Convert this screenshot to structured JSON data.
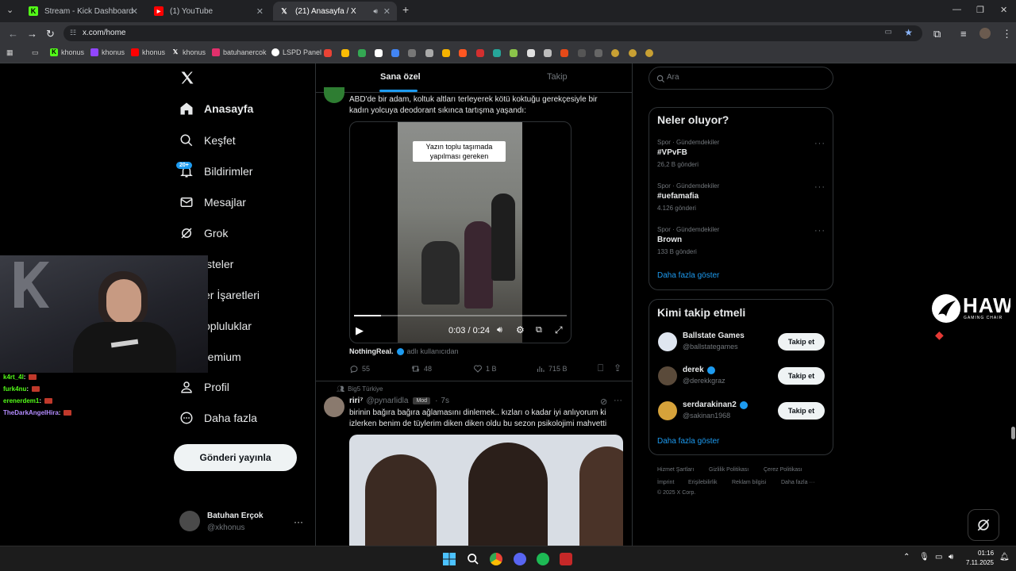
{
  "browser": {
    "tabs": [
      {
        "label": "Stream - Kick Dashboard",
        "icon": "kick-icon"
      },
      {
        "label": "(1) YouTube",
        "icon": "youtube-icon"
      },
      {
        "label": "(21) Anasayfa / X",
        "icon": "x-icon"
      }
    ],
    "url": "x.com/home",
    "bookmarks": [
      {
        "label": "khonus",
        "icon": "kick-icon",
        "color": "#53fc18"
      },
      {
        "label": "khonus",
        "icon": "twitch-icon",
        "color": "#9146ff"
      },
      {
        "label": "khonus",
        "icon": "youtube-icon",
        "color": "#ff0000"
      },
      {
        "label": "khonus",
        "icon": "x-icon",
        "color": "#ffffff"
      },
      {
        "label": "batuhanercok",
        "icon": "instagram-icon",
        "color": "#e1306c"
      },
      {
        "label": "LSPD Panel",
        "icon": "lspd-icon",
        "color": "#ffffff"
      }
    ]
  },
  "nav": {
    "items": [
      {
        "label": "Anasayfa",
        "icon": "home-icon"
      },
      {
        "label": "Keşfet",
        "icon": "search-icon"
      },
      {
        "label": "Bildirimler",
        "icon": "bell-icon"
      },
      {
        "label": "Mesajlar",
        "icon": "mail-icon"
      },
      {
        "label": "Grok",
        "icon": "grok-icon"
      },
      {
        "label": "isteler",
        "icon": "list-icon"
      },
      {
        "label": "er İşaretleri",
        "icon": "bookmark-icon"
      },
      {
        "label": "opluluklar",
        "icon": "community-icon"
      },
      {
        "label": "remium",
        "icon": "premium-icon"
      },
      {
        "label": "Profil",
        "icon": "profile-icon"
      },
      {
        "label": "Daha fazla",
        "icon": "more-icon"
      }
    ],
    "notification_badge": "20+",
    "post_button": "Gönderi yayınla",
    "account": {
      "name": "Batuhan Erçok",
      "handle": "@xkhonus"
    }
  },
  "feed": {
    "tabs": [
      "Sana özel",
      "Takip"
    ],
    "tweet1": {
      "text_line1": "ABD'de bir adam, koltuk altları terleyerek kötü koktuğu gerekçesiyle bir",
      "text_line2": "kadın yolcuya deodorant sıkınca tartışma yaşandı:",
      "video_caption": "Yazın toplu taşımada yapılması gereken",
      "video_time": "0:03 / 0:24",
      "video_progress": 0.125,
      "source_name": "NothingReal.",
      "source_suffix": "adlı kullanıcıdan",
      "replies": "55",
      "reposts": "48",
      "likes": "1 B",
      "views": "715 B"
    },
    "tweet2": {
      "community": "Big5 Türkiye",
      "author_name": "riri⁷",
      "author_handle": "@pynarlidla",
      "role_badge": "Mod",
      "time": "7s",
      "text_line1": "birinin bağıra bağıra ağlamasını dinlemek.. kızları o kadar iyi anlıyorum ki",
      "text_line2": "izlerken benim de tüylerim diken diken oldu bu sezon psikolojimi mahvetti"
    }
  },
  "right": {
    "search_placeholder": "Ara",
    "trends_title": "Neler oluyor?",
    "trends": [
      {
        "category": "Spor · Gündemdekiler",
        "name": "#VPvFB",
        "count": "26,2 B gönderi"
      },
      {
        "category": "Spor · Gündemdekiler",
        "name": "#uefamafia",
        "count": "4.126 gönderi"
      },
      {
        "category": "Spor · Gündemdekiler",
        "name": "Brown",
        "count": "133 B gönderi"
      }
    ],
    "show_more": "Daha fazla göster",
    "follow_title": "Kimi takip etmeli",
    "follow": [
      {
        "name": "Ballstate Games",
        "handle": "@ballstategames",
        "verified": false
      },
      {
        "name": "derek",
        "handle": "@derekkgraz",
        "verified": true
      },
      {
        "name": "serdarakinan2",
        "handle": "@sakinan1968",
        "verified": true
      }
    ],
    "follow_button": "Takip et",
    "footer_line1": [
      "Hizmet Şartları",
      "Gizlilik Politikası",
      "Çerez Politikası"
    ],
    "footer_line2": [
      "İmprint",
      "Erişilebilirlik",
      "Reklam bilgisi",
      "Daha fazla ···"
    ],
    "copyright": "© 2025 X Corp."
  },
  "overlay": {
    "sponsor": "HAWK",
    "sponsor_sub": "GAMING CHAIR",
    "chat": [
      {
        "user": "k4rt_4l",
        "color": "#53fc18"
      },
      {
        "user": "furk4nu",
        "color": "#53fc18"
      },
      {
        "user": "erenerdem1",
        "color": "#53fc18"
      },
      {
        "user": "TheDarkAngelHira",
        "color": "#b48cff"
      }
    ]
  },
  "taskbar": {
    "time": "01:16",
    "date": "7.11.2025"
  },
  "colors": {
    "accent": "#1d9bf0",
    "background": "#000000",
    "border": "#2f3336"
  }
}
